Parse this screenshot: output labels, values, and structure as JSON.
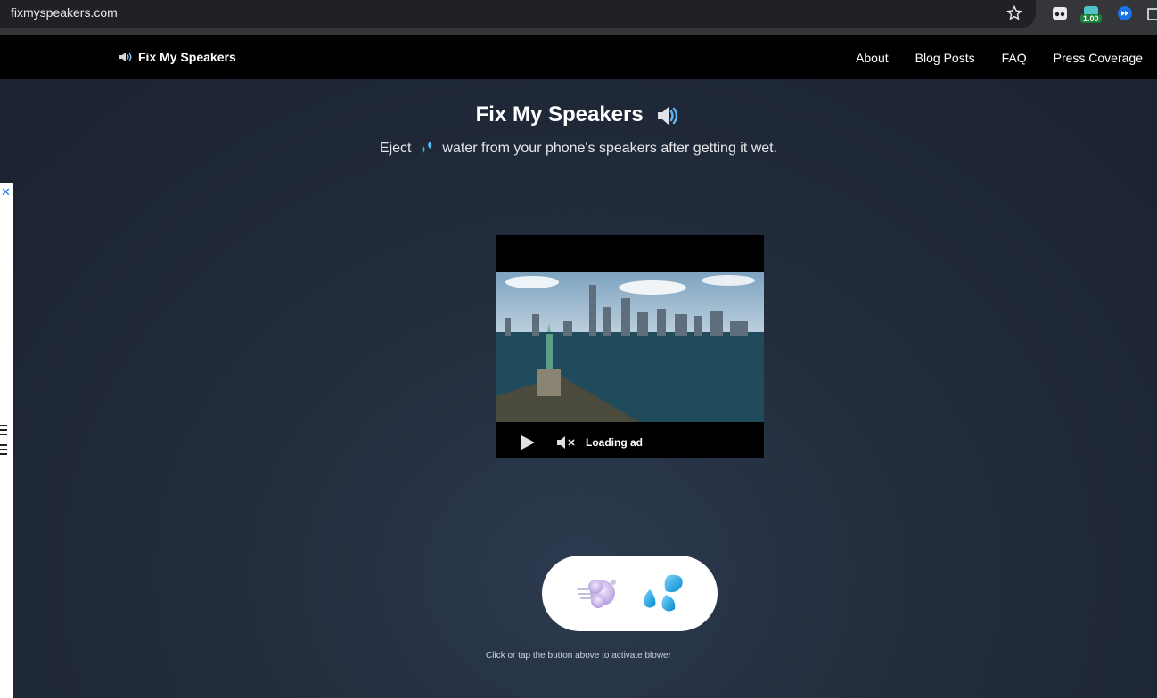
{
  "browser": {
    "url": "fixmyspeakers.com",
    "extension_badge": "1.00"
  },
  "nav": {
    "brand": "Fix My Speakers",
    "links": [
      "About",
      "Blog Posts",
      "FAQ",
      "Press Coverage"
    ]
  },
  "hero": {
    "title": "Fix My Speakers",
    "subtitle_before": "Eject",
    "subtitle_after": "water from your phone's speakers after getting it wet."
  },
  "ad": {
    "close_glyph": "✕",
    "status": "Loading ad"
  },
  "blower": {
    "hint": "Click or tap the button above to activate blower"
  },
  "colors": {
    "nav_bg": "#000000",
    "page_bg": "#1b2230",
    "accent_blue": "#29b6f6"
  }
}
